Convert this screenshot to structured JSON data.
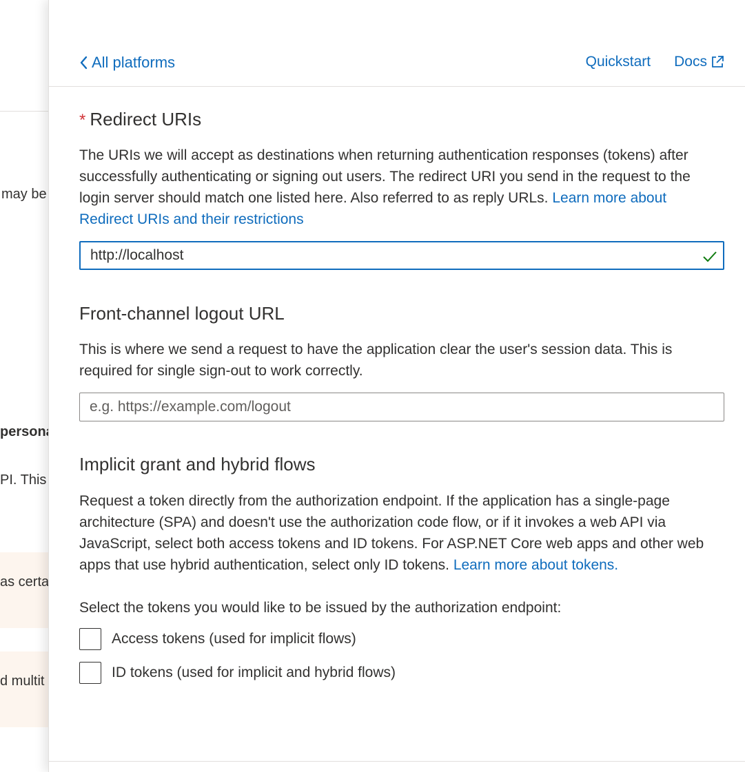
{
  "background": {
    "fragments": [
      "may  be",
      "persona",
      "PI. This",
      "as certa",
      "d multit"
    ]
  },
  "panel": {
    "back_label": "All platforms",
    "quickstart_label": "Quickstart",
    "docs_label": "Docs",
    "redirect": {
      "required_mark": "*",
      "title": "Redirect URIs",
      "description": "The URIs we will accept as destinations when returning authentication responses (tokens) after successfully authenticating or signing out users. The redirect URI you send in the request to the login server should match one listed here. Also referred to as reply URLs. ",
      "link_text": "Learn more about Redirect URIs and their restrictions",
      "value": "http://localhost"
    },
    "logout": {
      "title": "Front-channel logout URL",
      "description": "This is where we send a request to have the application clear the user's session data. This is required for single sign-out to work correctly.",
      "placeholder": "e.g. https://example.com/logout"
    },
    "implicit": {
      "title": "Implicit grant and hybrid flows",
      "description": "Request a token directly from the authorization endpoint. If the application has a single-page architecture (SPA) and doesn't use the authorization code flow, or if it invokes a web API via JavaScript, select both access tokens and ID tokens. For ASP.NET Core web apps and other web apps that use hybrid authentication, select only ID tokens. ",
      "link_text": "Learn more about tokens.",
      "select_prompt": "Select the tokens you would like to be issued by the authorization endpoint:",
      "options": [
        {
          "label": "Access tokens (used for implicit flows)",
          "checked": false
        },
        {
          "label": "ID tokens (used for implicit and hybrid flows)",
          "checked": false
        }
      ]
    }
  },
  "colors": {
    "accent": "#0f6cbd",
    "required": "#d13438",
    "success": "#107c10"
  }
}
